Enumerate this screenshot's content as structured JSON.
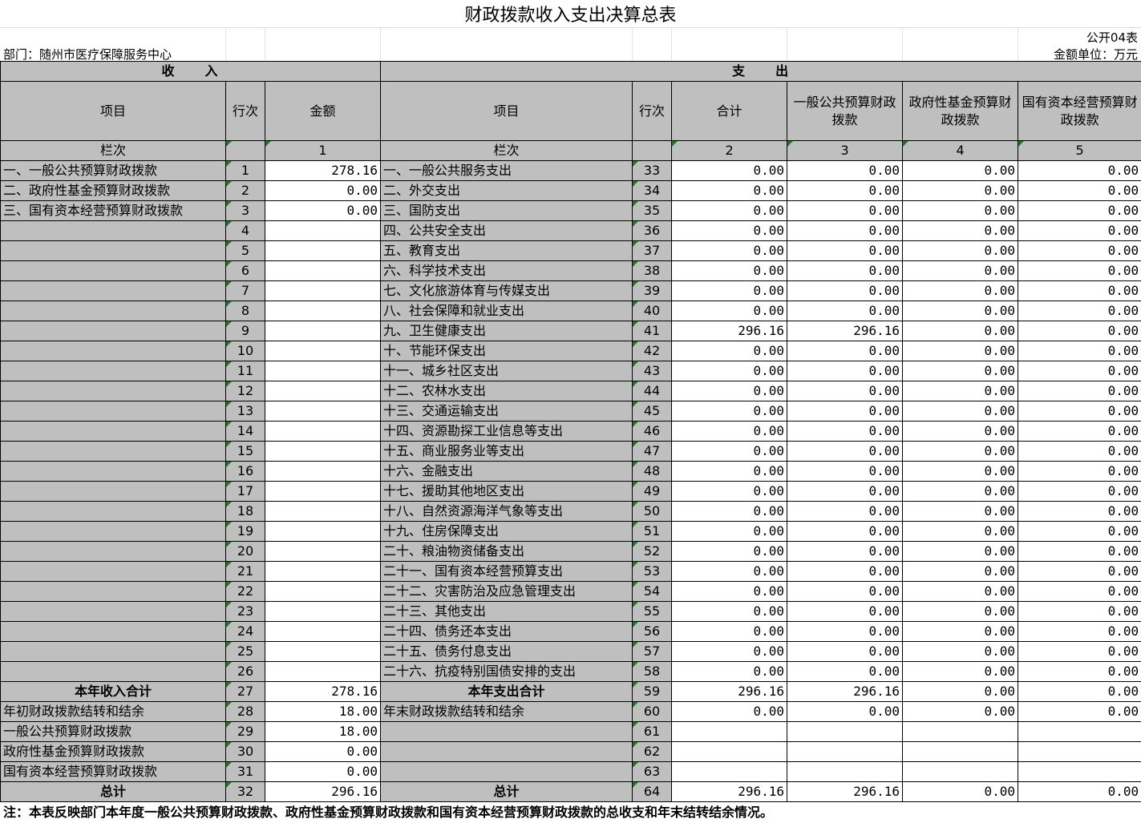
{
  "title": "财政拨款收入支出决算总表",
  "form_code": "公开04表",
  "department": "部门：随州市医疗保障服务中心",
  "unit": "金额单位：万元",
  "section_income": "收　　入",
  "section_expense": "支　　出",
  "headers": {
    "item": "项目",
    "row_no": "行次",
    "amount": "金额",
    "exp_item": "项目",
    "exp_row_no": "行次",
    "total": "合计",
    "general": "一般公共预算财政拨款",
    "fund": "政府性基金预算财政拨款",
    "state": "国有资本经营预算财政拨款"
  },
  "index_row": {
    "label": "栏次",
    "c1": "1",
    "label2": "栏次",
    "c2": "2",
    "c3": "3",
    "c4": "4",
    "c5": "5"
  },
  "rows": [
    {
      "ii": "一、一般公共预算财政拨款",
      "ir": "1",
      "ia": "278.16",
      "ei": "一、一般公共服务支出",
      "er": "33",
      "t": "0.00",
      "g": "0.00",
      "f": "0.00",
      "s": "0.00"
    },
    {
      "ii": "二、政府性基金预算财政拨款",
      "ir": "2",
      "ia": "0.00",
      "ei": "二、外交支出",
      "er": "34",
      "t": "0.00",
      "g": "0.00",
      "f": "0.00",
      "s": "0.00"
    },
    {
      "ii": "三、国有资本经营预算财政拨款",
      "ir": "3",
      "ia": "0.00",
      "ei": "三、国防支出",
      "er": "35",
      "t": "0.00",
      "g": "0.00",
      "f": "0.00",
      "s": "0.00"
    },
    {
      "ii": "",
      "ir": "4",
      "ia": "",
      "ei": "四、公共安全支出",
      "er": "36",
      "t": "0.00",
      "g": "0.00",
      "f": "0.00",
      "s": "0.00"
    },
    {
      "ii": "",
      "ir": "5",
      "ia": "",
      "ei": "五、教育支出",
      "er": "37",
      "t": "0.00",
      "g": "0.00",
      "f": "0.00",
      "s": "0.00"
    },
    {
      "ii": "",
      "ir": "6",
      "ia": "",
      "ei": "六、科学技术支出",
      "er": "38",
      "t": "0.00",
      "g": "0.00",
      "f": "0.00",
      "s": "0.00"
    },
    {
      "ii": "",
      "ir": "7",
      "ia": "",
      "ei": "七、文化旅游体育与传媒支出",
      "er": "39",
      "t": "0.00",
      "g": "0.00",
      "f": "0.00",
      "s": "0.00"
    },
    {
      "ii": "",
      "ir": "8",
      "ia": "",
      "ei": "八、社会保障和就业支出",
      "er": "40",
      "t": "0.00",
      "g": "0.00",
      "f": "0.00",
      "s": "0.00"
    },
    {
      "ii": "",
      "ir": "9",
      "ia": "",
      "ei": "九、卫生健康支出",
      "er": "41",
      "t": "296.16",
      "g": "296.16",
      "f": "0.00",
      "s": "0.00"
    },
    {
      "ii": "",
      "ir": "10",
      "ia": "",
      "ei": "十、节能环保支出",
      "er": "42",
      "t": "0.00",
      "g": "0.00",
      "f": "0.00",
      "s": "0.00"
    },
    {
      "ii": "",
      "ir": "11",
      "ia": "",
      "ei": "十一、城乡社区支出",
      "er": "43",
      "t": "0.00",
      "g": "0.00",
      "f": "0.00",
      "s": "0.00"
    },
    {
      "ii": "",
      "ir": "12",
      "ia": "",
      "ei": "十二、农林水支出",
      "er": "44",
      "t": "0.00",
      "g": "0.00",
      "f": "0.00",
      "s": "0.00"
    },
    {
      "ii": "",
      "ir": "13",
      "ia": "",
      "ei": "十三、交通运输支出",
      "er": "45",
      "t": "0.00",
      "g": "0.00",
      "f": "0.00",
      "s": "0.00"
    },
    {
      "ii": "",
      "ir": "14",
      "ia": "",
      "ei": "十四、资源勘探工业信息等支出",
      "er": "46",
      "t": "0.00",
      "g": "0.00",
      "f": "0.00",
      "s": "0.00"
    },
    {
      "ii": "",
      "ir": "15",
      "ia": "",
      "ei": "十五、商业服务业等支出",
      "er": "47",
      "t": "0.00",
      "g": "0.00",
      "f": "0.00",
      "s": "0.00"
    },
    {
      "ii": "",
      "ir": "16",
      "ia": "",
      "ei": "十六、金融支出",
      "er": "48",
      "t": "0.00",
      "g": "0.00",
      "f": "0.00",
      "s": "0.00"
    },
    {
      "ii": "",
      "ir": "17",
      "ia": "",
      "ei": "十七、援助其他地区支出",
      "er": "49",
      "t": "0.00",
      "g": "0.00",
      "f": "0.00",
      "s": "0.00"
    },
    {
      "ii": "",
      "ir": "18",
      "ia": "",
      "ei": "十八、自然资源海洋气象等支出",
      "er": "50",
      "t": "0.00",
      "g": "0.00",
      "f": "0.00",
      "s": "0.00"
    },
    {
      "ii": "",
      "ir": "19",
      "ia": "",
      "ei": "十九、住房保障支出",
      "er": "51",
      "t": "0.00",
      "g": "0.00",
      "f": "0.00",
      "s": "0.00"
    },
    {
      "ii": "",
      "ir": "20",
      "ia": "",
      "ei": "二十、粮油物资储备支出",
      "er": "52",
      "t": "0.00",
      "g": "0.00",
      "f": "0.00",
      "s": "0.00"
    },
    {
      "ii": "",
      "ir": "21",
      "ia": "",
      "ei": "二十一、国有资本经营预算支出",
      "er": "53",
      "t": "0.00",
      "g": "0.00",
      "f": "0.00",
      "s": "0.00"
    },
    {
      "ii": "",
      "ir": "22",
      "ia": "",
      "ei": "二十二、灾害防治及应急管理支出",
      "er": "54",
      "t": "0.00",
      "g": "0.00",
      "f": "0.00",
      "s": "0.00"
    },
    {
      "ii": "",
      "ir": "23",
      "ia": "",
      "ei": "二十三、其他支出",
      "er": "55",
      "t": "0.00",
      "g": "0.00",
      "f": "0.00",
      "s": "0.00"
    },
    {
      "ii": "",
      "ir": "24",
      "ia": "",
      "ei": "二十四、债务还本支出",
      "er": "56",
      "t": "0.00",
      "g": "0.00",
      "f": "0.00",
      "s": "0.00"
    },
    {
      "ii": "",
      "ir": "25",
      "ia": "",
      "ei": "二十五、债务付息支出",
      "er": "57",
      "t": "0.00",
      "g": "0.00",
      "f": "0.00",
      "s": "0.00"
    },
    {
      "ii": "",
      "ir": "26",
      "ia": "",
      "ei": "二十六、抗疫特别国债安排的支出",
      "er": "58",
      "t": "0.00",
      "g": "0.00",
      "f": "0.00",
      "s": "0.00"
    }
  ],
  "summary": [
    {
      "ii": "本年收入合计",
      "ir": "27",
      "ia": "278.16",
      "ei": "本年支出合计",
      "er": "59",
      "t": "296.16",
      "g": "296.16",
      "f": "0.00",
      "s": "0.00"
    },
    {
      "ii": "年初财政拨款结转和结余",
      "ir": "28",
      "ia": "18.00",
      "ei": "年末财政拨款结转和结余",
      "er": "60",
      "t": "0.00",
      "g": "0.00",
      "f": "0.00",
      "s": "0.00"
    },
    {
      "ii": "一般公共预算财政拨款",
      "ir": "29",
      "ia": "18.00",
      "ei": "",
      "er": "61",
      "t": "",
      "g": "",
      "f": "",
      "s": ""
    },
    {
      "ii": "政府性基金预算财政拨款",
      "ir": "30",
      "ia": "0.00",
      "ei": "",
      "er": "62",
      "t": "",
      "g": "",
      "f": "",
      "s": ""
    },
    {
      "ii": "国有资本经营预算财政拨款",
      "ir": "31",
      "ia": "0.00",
      "ei": "",
      "er": "63",
      "t": "",
      "g": "",
      "f": "",
      "s": ""
    },
    {
      "ii": "总计",
      "ir": "32",
      "ia": "296.16",
      "ei": "总计",
      "er": "64",
      "t": "296.16",
      "g": "296.16",
      "f": "0.00",
      "s": "0.00"
    }
  ],
  "note": "注：本表反映部门本年度一般公共预算财政拨款、政府性基金预算财政拨款和国有资本经营预算财政拨款的总收支和年末结转结余情况。"
}
